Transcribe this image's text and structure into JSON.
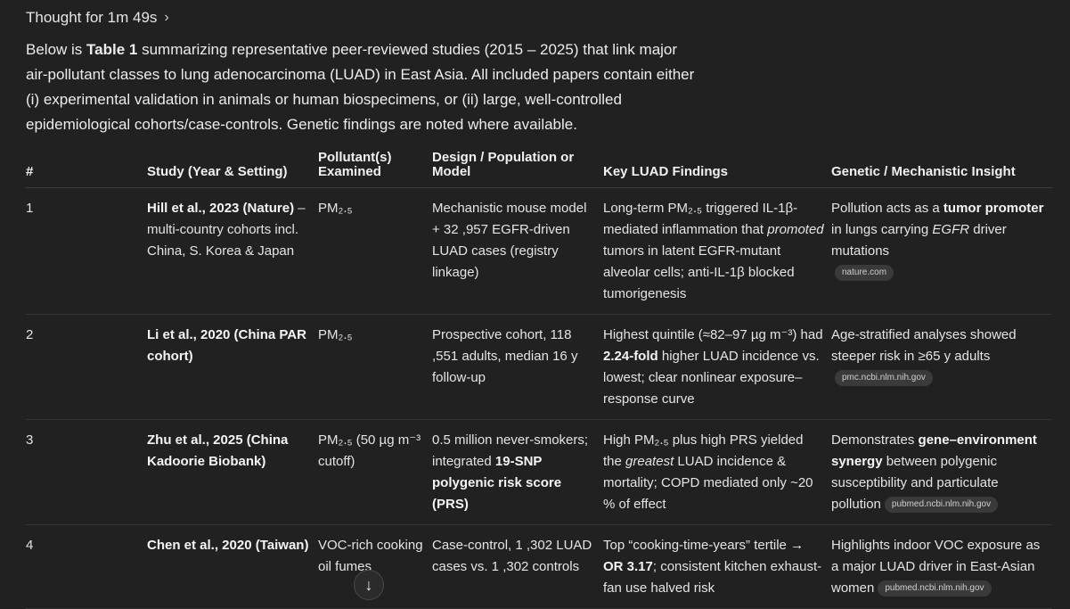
{
  "thought": {
    "label": "Thought for 1m 49s",
    "chevron": "›"
  },
  "intro": {
    "p1": "Below is ",
    "bold": "Table 1",
    "p2": " summarizing representative peer-reviewed studies (2015 – 2025) that link major air-pollutant classes to lung adenocarcinoma (LUAD) in East Asia. All included papers contain either (i) experimental validation in animals or human biospecimens, or (ii) large, well-controlled epidemiological cohorts/case-controls. Genetic findings are noted where available."
  },
  "table": {
    "headers": [
      "#",
      "Study (Year & Setting)",
      "Pollutant(s) Examined",
      "Design / Population or Model",
      "Key LUAD Findings",
      "Genetic / Mechanistic Insight"
    ],
    "rows": [
      {
        "num": "1",
        "study_bold": "Hill et al., 2023 (Nature)",
        "study_rest": " – multi-country cohorts incl. China, S. Korea & Japan",
        "pollutant": "PM₂.₅",
        "design": "Mechanistic mouse model + 32 ,957 EGFR-driven LUAD cases (registry linkage)",
        "finding_a": "Long-term PM₂.₅ triggered IL-1β-mediated inflammation that ",
        "finding_i": "promoted",
        "finding_b": " tumors in latent EGFR-mutant alveolar cells; anti-IL-1β blocked tumorigenesis",
        "gen_a": "Pollution acts as a ",
        "gen_b": "tumor promoter",
        "gen_c": " in lungs carrying ",
        "gen_i": "EGFR",
        "gen_d": " driver mutations",
        "source": "nature.com"
      },
      {
        "num": "2",
        "study_bold": "Li et al., 2020 (China PAR cohort)",
        "pollutant": "PM₂.₅",
        "design": "Prospective cohort, 118 ,551 adults, median 16 y follow-up",
        "finding_a": "Highest quintile (≈82–97 µg m⁻³) had ",
        "finding_b": "2.24-fold",
        "finding_c": " higher LUAD incidence vs. lowest; clear nonlinear exposure–response curve",
        "gen_a": "Age-stratified analyses showed steeper risk in ≥65 y adults",
        "source": "pmc.ncbi.nlm.nih.gov"
      },
      {
        "num": "3",
        "study_bold": "Zhu et al., 2025 (China Kadoorie Biobank)",
        "pollutant": "PM₂.₅ (50 µg m⁻³ cutoff)",
        "design_a": "0.5 million never-smokers; integrated ",
        "design_b": "19-SNP polygenic risk score (PRS)",
        "finding_a": "High PM₂.₅ plus high PRS yielded the ",
        "finding_i": "greatest",
        "finding_b": " LUAD incidence & mortality; COPD mediated only ~20 % of effect",
        "gen_a": "Demonstrates ",
        "gen_b": "gene–environment synergy",
        "gen_c": " between polygenic susceptibility and particulate pollution",
        "source": "pubmed.ncbi.nlm.nih.gov"
      },
      {
        "num": "4",
        "study_bold": "Chen et al., 2020 (Taiwan)",
        "pollutant": "VOC-rich cooking oil fumes",
        "design": "Case-control, 1 ,302 LUAD cases vs. 1 ,302 controls",
        "finding_a": "Top “cooking-time-years” tertile ",
        "finding_b": "→ OR 3.17",
        "finding_c": "; consistent kitchen exhaust-fan use halved risk",
        "gen_a": "Highlights indoor VOC exposure as a major LUAD driver in East-Asian women",
        "source": "pubmed.ncbi.nlm.nih.gov"
      }
    ]
  },
  "scroll_button": {
    "icon": "↓"
  }
}
